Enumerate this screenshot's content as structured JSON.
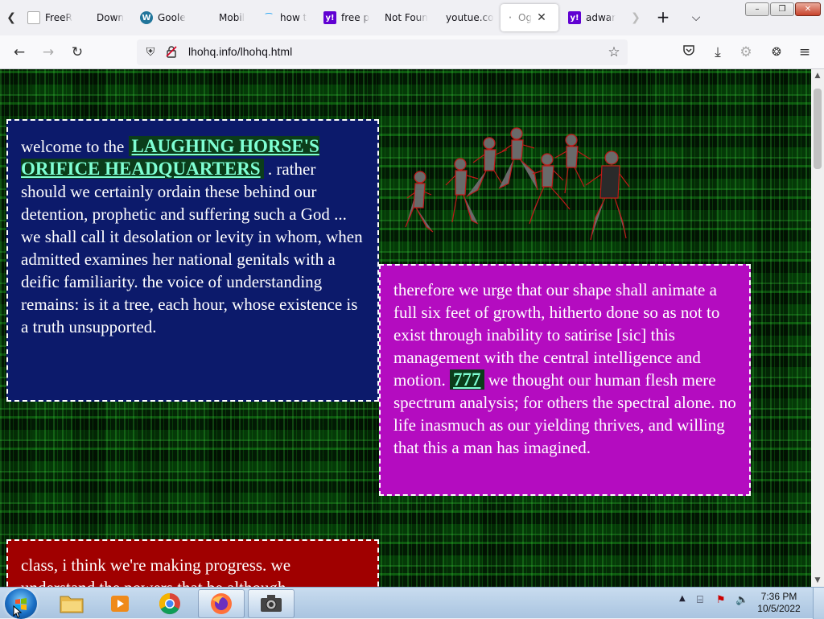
{
  "browser": {
    "tabs": [
      {
        "label": "FreeR",
        "favicon": "page-icon",
        "active": false
      },
      {
        "label": "Down",
        "favicon": "none",
        "active": false
      },
      {
        "label": "Goole",
        "favicon": "wordpress-icon",
        "active": false
      },
      {
        "label": "Mobil",
        "favicon": "none",
        "active": false
      },
      {
        "label": "how t",
        "favicon": "bird-icon",
        "active": false
      },
      {
        "label": "free p",
        "favicon": "yahoo-icon",
        "active": false
      },
      {
        "label": "Not Foun",
        "favicon": "none",
        "active": false
      },
      {
        "label": "youtue.co",
        "favicon": "none",
        "active": false
      },
      {
        "label": "Og",
        "favicon": "page-icon",
        "active": true
      },
      {
        "label": "adwar",
        "favicon": "yahoo-icon",
        "active": false
      }
    ],
    "url": "lhohq.info/lhohq.html"
  },
  "page": {
    "blue_box": {
      "intro": "welcome to the ",
      "link": "LAUGHING HORSE'S ORIFICE HEADQUARTERS",
      "body": ". rather should we certainly ordain these behind our detention, prophetic and suffering such a God ... we shall call it desolation or levity in whom, when admitted examines her national genitals with a deific familiarity. the voice of understanding remains: is it a tree, each hour, whose existence is a truth unsupported."
    },
    "magenta_box": {
      "text_before": "therefore we urge that our shape shall animate a full six feet of growth, hitherto done so as not to exist through inability to satirise [sic] this management with the central intelligence and motion. ",
      "link": "777",
      "text_after": " we thought our human flesh mere spectrum analysis; for others the spectral alone. no life inasmuch as our yielding thrives, and willing that this a man has imagined."
    },
    "red_box": {
      "text": "class, i think we're making progress. we understand the powers that be although"
    }
  },
  "taskbar": {
    "time": "7:36 PM",
    "date": "10/5/2022"
  },
  "colors": {
    "blue_box": "#0c1a6b",
    "magenta_box": "#b40cc0",
    "red_box": "#a00000",
    "link": "#7fffd4",
    "page_bg": "#053a08"
  }
}
